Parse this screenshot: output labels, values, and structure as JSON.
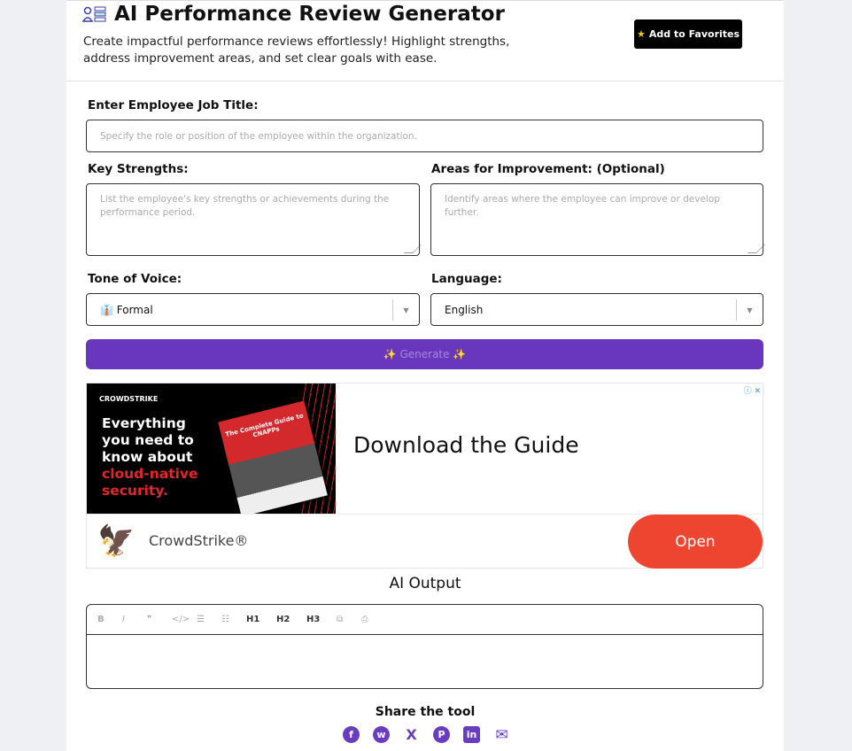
{
  "header": {
    "title": "AI Performance Review Generator",
    "description": "Create impactful performance reviews effortlessly! Highlight strengths, address improvement areas, and set clear goals with ease.",
    "favorites_label": "Add to Favorites"
  },
  "form": {
    "job_title": {
      "label": "Enter Employee Job Title:",
      "placeholder": "Specify the role or position of the employee within the organization."
    },
    "strengths": {
      "label": "Key Strengths:",
      "placeholder": "List the employee's key strengths or achievements during the performance period."
    },
    "improvement": {
      "label": "Areas for Improvement: (Optional)",
      "placeholder": "Identify areas where the employee can improve or develop further."
    },
    "tone": {
      "label": "Tone of Voice:",
      "value": "👔 Formal"
    },
    "language": {
      "label": "Language:",
      "value": "English"
    },
    "generate_label": "✨ Generate ✨"
  },
  "ad": {
    "brand": "CROWDSTRIKE",
    "headline_1": "Everything you need to know about",
    "headline_2": "cloud-native security.",
    "book_title": "The Complete Guide to CNAPPs",
    "cta_text": "Download the Guide",
    "advertiser": "CrowdStrike®",
    "open_label": "Open",
    "adchoices": "ⓘ ✕"
  },
  "output": {
    "title": "AI Output",
    "toolbar": [
      "B",
      "I",
      "❞",
      "</>",
      "☰",
      "☷",
      "H1",
      "H2",
      "H3",
      "⧉",
      "⎙"
    ]
  },
  "share": {
    "title": "Share the tool",
    "icons": [
      "facebook-icon",
      "whatsapp-icon",
      "x-icon",
      "pinterest-icon",
      "linkedin-icon",
      "email-icon"
    ],
    "glyphs": [
      "f",
      "w",
      "X",
      "P",
      "in",
      "✉"
    ]
  },
  "colors": {
    "accent": "#6937bd",
    "cta": "#ee4530"
  }
}
